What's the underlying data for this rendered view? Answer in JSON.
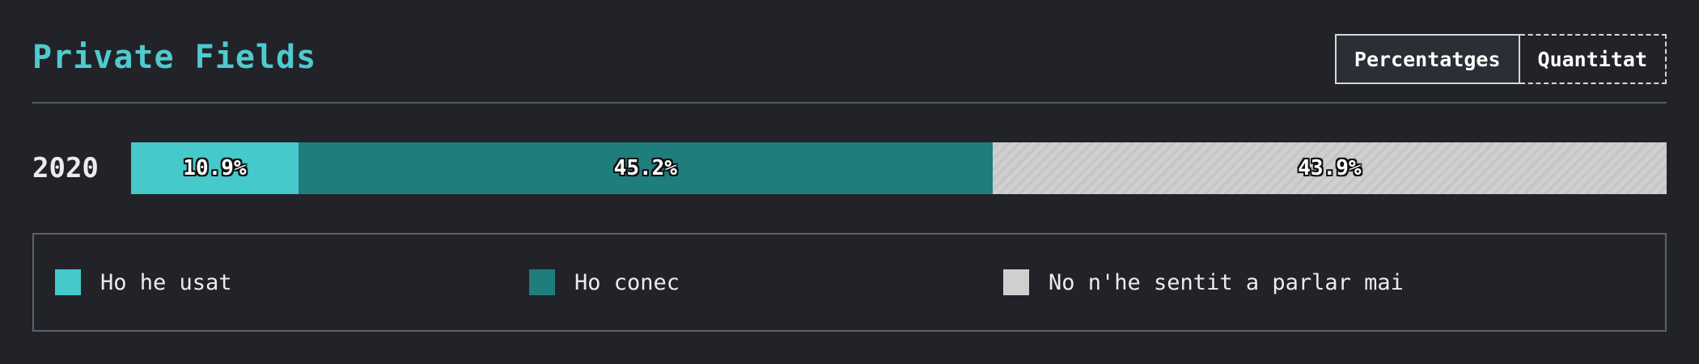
{
  "header": {
    "title": "Private Fields",
    "title_color": "#4ecbcd",
    "toggle": {
      "percent_label": "Percentatges",
      "count_label": "Quantitat",
      "active": "percent"
    }
  },
  "colors": {
    "used": "#45c9cb",
    "known": "#1f7d7c",
    "never_heard": "#cfcfcf",
    "background": "#222329"
  },
  "chart_data": {
    "type": "bar",
    "orientation": "horizontal",
    "stacked": true,
    "normalized": true,
    "categories": [
      "2020"
    ],
    "series": [
      {
        "name": "Ho he usat",
        "values": [
          10.9
        ],
        "color": "#45c9cb",
        "pattern": "solid"
      },
      {
        "name": "Ho conec",
        "values": [
          45.2
        ],
        "color": "#1f7d7c",
        "pattern": "solid"
      },
      {
        "name": "No n'he sentit a parlar mai",
        "values": [
          43.9
        ],
        "color": "#cfcfcf",
        "pattern": "hatched"
      }
    ],
    "data_labels": [
      "10.9%",
      "45.2%",
      "43.9%"
    ],
    "xlim": [
      0,
      100
    ],
    "unit": "%",
    "legend": "bottom",
    "grid": false
  }
}
